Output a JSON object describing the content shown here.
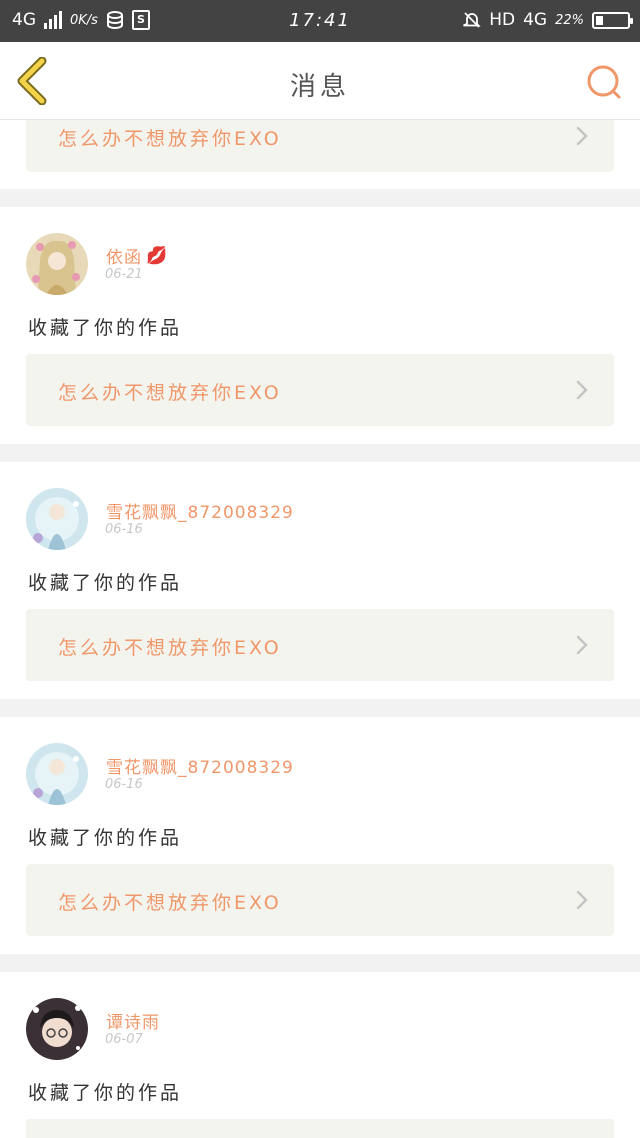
{
  "status_bar": {
    "network": "4G",
    "speed": "0K/s",
    "time": "17:41",
    "hd": "HD",
    "network_right": "4G",
    "battery": "22%",
    "battery_level": 0.22
  },
  "header": {
    "title": "消息",
    "back_icon": "chevron-left-icon",
    "search_icon": "search-icon"
  },
  "messages": [
    {
      "work_title": "怎么办不想放弃你EXO"
    },
    {
      "username": "依函",
      "badge": "💋",
      "date": "06-21",
      "action": "收藏了你的作品",
      "work_title": "怎么办不想放弃你EXO"
    },
    {
      "username": "雪花飘飘_872008329",
      "date": "06-16",
      "action": "收藏了你的作品",
      "work_title": "怎么办不想放弃你EXO"
    },
    {
      "username": "雪花飘飘_872008329",
      "date": "06-16",
      "action": "收藏了你的作品",
      "work_title": "怎么办不想放弃你EXO"
    },
    {
      "username": "谭诗雨",
      "date": "06-07",
      "action": "收藏了你的作品"
    }
  ],
  "colors": {
    "accent": "#f0976a",
    "status_bar_bg": "#434343",
    "work_bg": "#f4f4ef"
  }
}
